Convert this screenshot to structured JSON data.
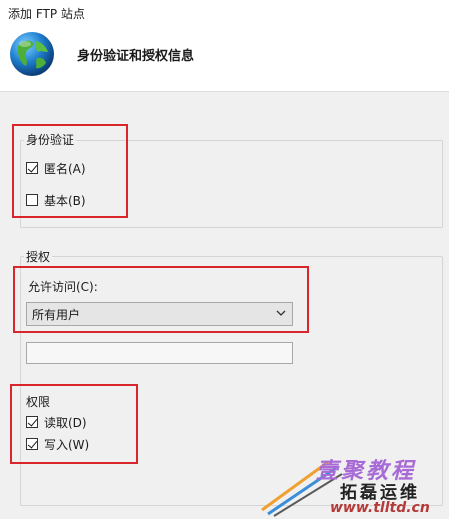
{
  "window": {
    "title": "添加 FTP 站点"
  },
  "header": {
    "page_title": "身份验证和授权信息",
    "icon": "globe-icon"
  },
  "authentication": {
    "title": "身份验证",
    "anonymous": {
      "label": "匿名(A)",
      "checked": true
    },
    "basic": {
      "label": "基本(B)",
      "checked": false
    }
  },
  "authorization": {
    "title": "授权",
    "allow_access_label": "允许访问(C):",
    "allow_access_value": "所有用户",
    "user_field_value": "",
    "permissions": {
      "title": "权限",
      "read": {
        "label": "读取(D)",
        "checked": true
      },
      "write": {
        "label": "写入(W)",
        "checked": true
      }
    }
  },
  "watermark": {
    "brand": "壹聚教程",
    "subtitle": "拓磊运维",
    "url": "www.tlltd.cn"
  },
  "colors": {
    "highlight_red": "#d9262c",
    "background": "#f0f0f0",
    "header_bg": "#ffffff"
  }
}
